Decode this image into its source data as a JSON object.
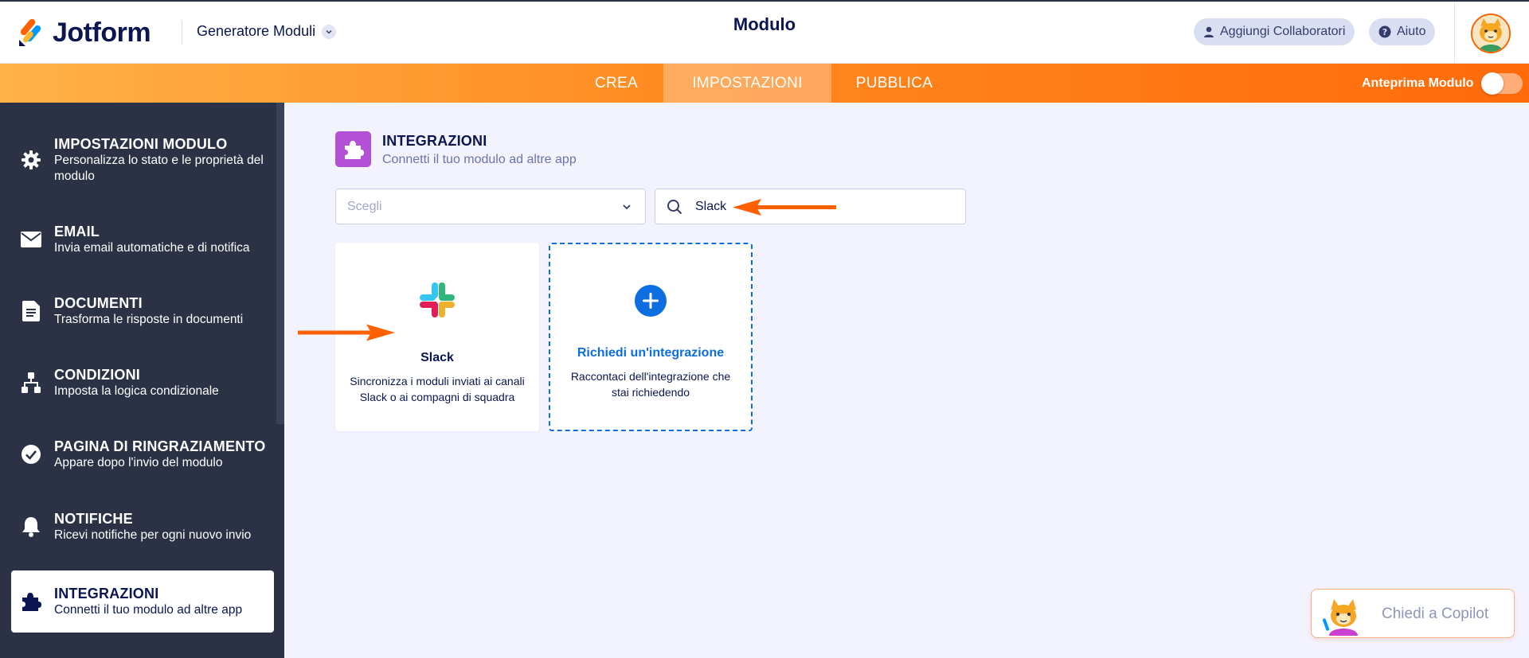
{
  "header": {
    "logo_text": "Jotform",
    "generator_menu": "Generatore Moduli",
    "page_title": "Modulo",
    "add_collaborators": "Aggiungi Collaboratori",
    "help": "Aiuto"
  },
  "nav": {
    "tabs": [
      {
        "label": "CREA"
      },
      {
        "label": "IMPOSTAZIONI",
        "active": true
      },
      {
        "label": "PUBBLICA"
      }
    ],
    "preview_label": "Anteprima Modulo"
  },
  "sidebar": {
    "items": [
      {
        "title": "IMPOSTAZIONI MODULO",
        "desc": "Personalizza lo stato e le proprietà del modulo",
        "icon": "gear-icon"
      },
      {
        "title": "EMAIL",
        "desc": "Invia email automatiche e di notifica",
        "icon": "envelope-icon"
      },
      {
        "title": "DOCUMENTI",
        "desc": "Trasforma le risposte in documenti",
        "icon": "document-icon"
      },
      {
        "title": "CONDIZIONI",
        "desc": "Imposta la logica condizionale",
        "icon": "flow-icon"
      },
      {
        "title": "PAGINA DI RINGRAZIAMENTO",
        "desc": "Appare dopo l'invio del modulo",
        "icon": "check-circle-icon"
      },
      {
        "title": "NOTIFICHE",
        "desc": "Ricevi notifiche per ogni nuovo invio",
        "icon": "bell-icon"
      },
      {
        "title": "INTEGRAZIONI",
        "desc": "Connetti il tuo modulo ad altre app",
        "icon": "puzzle-icon",
        "active": true
      }
    ]
  },
  "integrations": {
    "title": "INTEGRAZIONI",
    "subtitle": "Connetti il tuo modulo ad altre app",
    "select_placeholder": "Scegli",
    "search_value": "Slack",
    "cards": [
      {
        "title": "Slack",
        "desc": "Sincronizza i moduli inviati ai canali Slack o ai compagni di squadra",
        "icon": "slack-logo-icon"
      },
      {
        "title": "Richiedi un'integrazione",
        "desc": "Raccontaci dell'integrazione che stai richiedendo",
        "icon": "plus-circle-icon"
      }
    ]
  },
  "copilot": {
    "label": "Chiedi a Copilot"
  },
  "colors": {
    "accent_orange": "#ff6100",
    "sidebar_bg": "#2b3245",
    "primary_blue": "#0c6ee0",
    "integration_purple": "#b350d6"
  }
}
